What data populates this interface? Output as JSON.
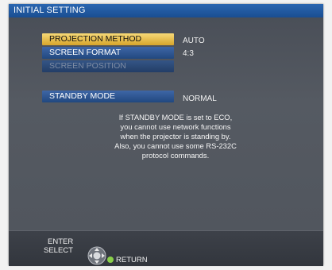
{
  "window": {
    "title": "INITIAL SETTING"
  },
  "menu": {
    "items": [
      {
        "label": "PROJECTION METHOD",
        "value": "AUTO",
        "state": "selected"
      },
      {
        "label": "SCREEN FORMAT",
        "value": "4:3",
        "state": "normal"
      },
      {
        "label": "SCREEN POSITION",
        "value": "",
        "state": "disabled"
      },
      {
        "label": "STANDBY MODE",
        "value": "NORMAL",
        "state": "normal"
      }
    ]
  },
  "message": {
    "lines": [
      "If STANDBY MODE is set to ECO,",
      "you cannot use network functions",
      "when the projector is standing by.",
      "Also, you cannot use some RS-232C",
      "protocol commands."
    ]
  },
  "footer": {
    "enter_label": "ENTER",
    "select_label": "SELECT",
    "return_label": "RETURN",
    "icon": "navigation-pad-icon"
  },
  "colors": {
    "title_bar": "#1f56a0",
    "selected_item": "#e8bf4b",
    "menu_item": "#2f5590",
    "panel_background": "#50555d"
  }
}
